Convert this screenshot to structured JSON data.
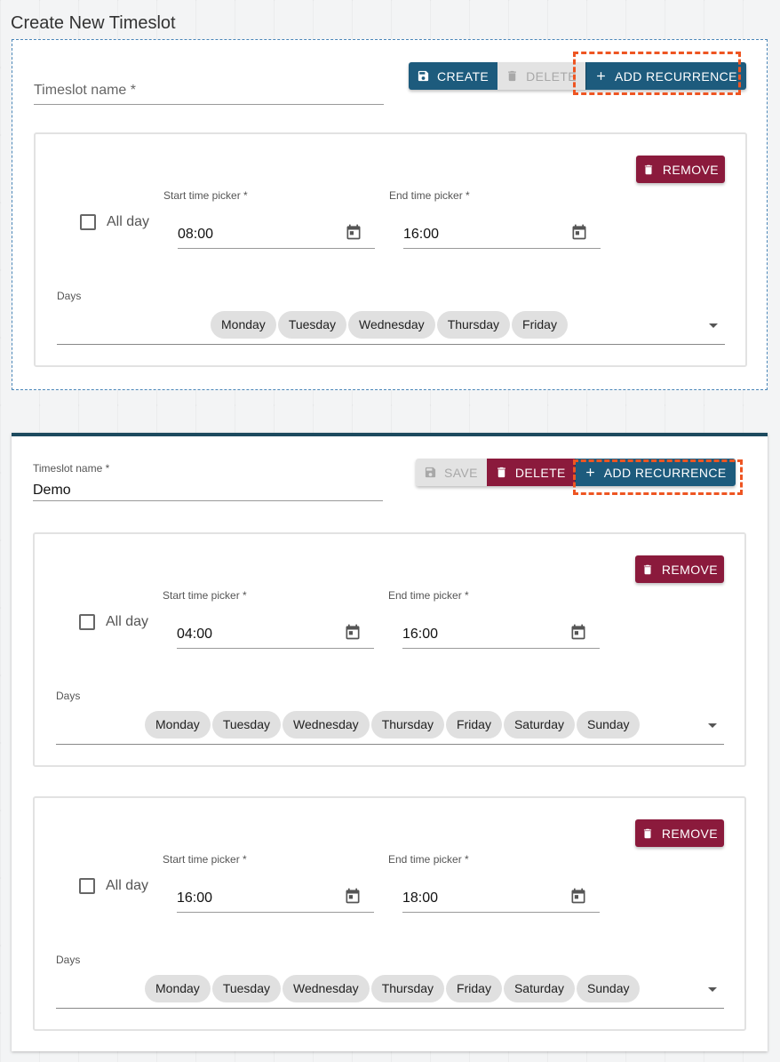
{
  "page": {
    "title": "Create New Timeslot"
  },
  "new_timeslot": {
    "name_placeholder": "Timeslot name *",
    "buttons": {
      "create": "CREATE",
      "delete": "DELETE",
      "add_recurrence": "ADD RECURRENCE"
    },
    "recurrences": [
      {
        "remove": "REMOVE",
        "all_day_label": "All day",
        "all_day_checked": false,
        "start_label": "Start time picker *",
        "start_value": "08:00",
        "end_label": "End time picker *",
        "end_value": "16:00",
        "days_label": "Days",
        "days": [
          "Monday",
          "Tuesday",
          "Wednesday",
          "Thursday",
          "Friday"
        ]
      }
    ]
  },
  "demo_timeslot": {
    "name_label": "Timeslot name *",
    "name_value": "Demo",
    "buttons": {
      "save": "SAVE",
      "delete": "DELETE",
      "add_recurrence": "ADD RECURRENCE"
    },
    "recurrences": [
      {
        "remove": "REMOVE",
        "all_day_label": "All day",
        "all_day_checked": false,
        "start_label": "Start time picker *",
        "start_value": "04:00",
        "end_label": "End time picker *",
        "end_value": "16:00",
        "days_label": "Days",
        "days": [
          "Monday",
          "Tuesday",
          "Wednesday",
          "Thursday",
          "Friday",
          "Saturday",
          "Sunday"
        ]
      },
      {
        "remove": "REMOVE",
        "all_day_label": "All day",
        "all_day_checked": false,
        "start_label": "Start time picker *",
        "start_value": "16:00",
        "end_label": "End time picker *",
        "end_value": "18:00",
        "days_label": "Days",
        "days": [
          "Monday",
          "Tuesday",
          "Wednesday",
          "Thursday",
          "Friday",
          "Saturday",
          "Sunday"
        ]
      }
    ]
  },
  "icons": {
    "save": "floppy-icon",
    "delete": "trash-icon",
    "add": "plus-icon",
    "calendar": "calendar-icon",
    "dropdown": "caret-down-icon"
  },
  "colors": {
    "primary": "#1d5b7d",
    "danger": "#8b1a3c",
    "disabled": "#e3e3e3",
    "highlight": "#ee5522",
    "panel_top_border": "#1c4a5e"
  }
}
